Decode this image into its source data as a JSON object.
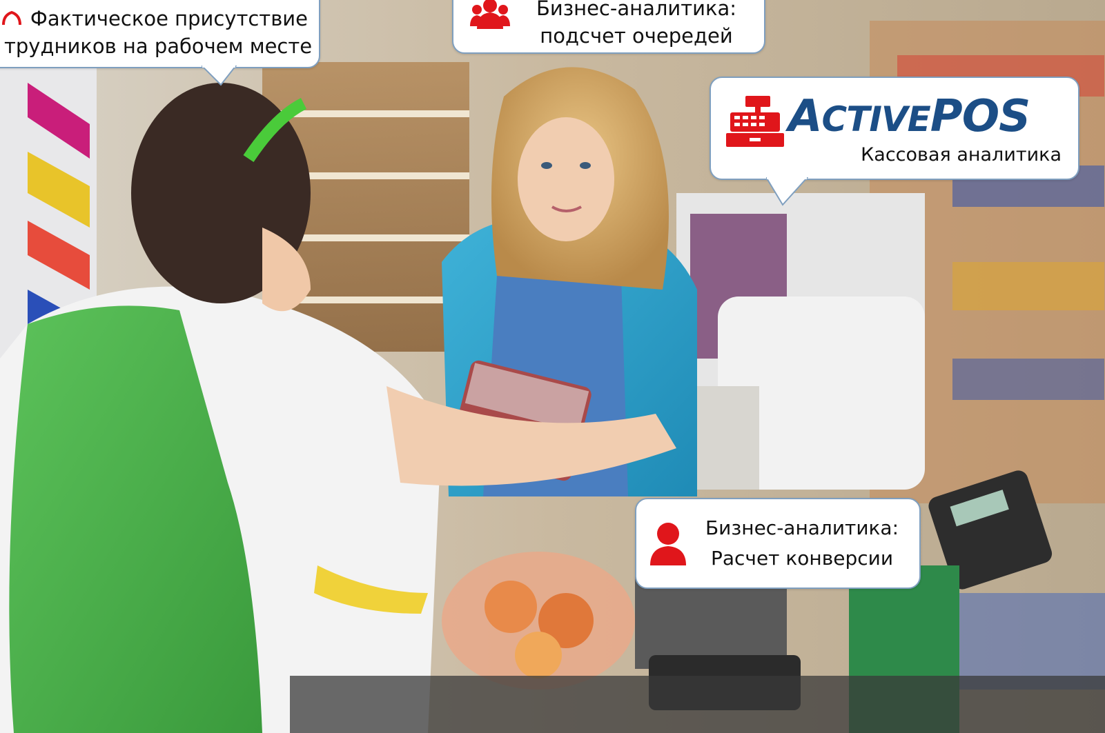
{
  "callouts": {
    "presence": {
      "line1": "Фактическое присутствие",
      "line2": "трудников на рабочем месте",
      "icon": "person-outline-icon"
    },
    "queue": {
      "line1": "Бизнес-аналитика:",
      "line2": "подсчет очередей",
      "icon": "people-group-icon"
    },
    "pos": {
      "brand_a": "A",
      "brand_b": "CTIVE",
      "brand_c": "POS",
      "subtitle": "Кассовая аналитика",
      "icon": "cash-register-icon"
    },
    "conversion": {
      "line1": "Бизнес-аналитика:",
      "line2": "Расчет конверсии",
      "icon": "person-icon"
    }
  },
  "colors": {
    "accent_red": "#e0161b",
    "brand_blue": "#1c4e86",
    "bubble_border": "#7f9fbf"
  }
}
